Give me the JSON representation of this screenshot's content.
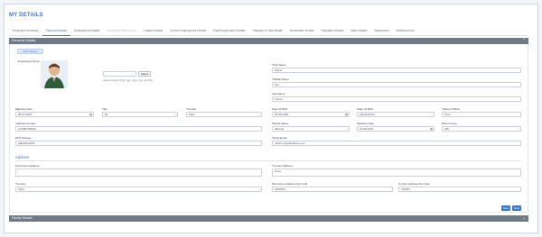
{
  "page": {
    "title": "MY DETAILS"
  },
  "tabs": [
    {
      "label": "Employee Summary",
      "state": "normal"
    },
    {
      "label": "Personal Details",
      "state": "active"
    },
    {
      "label": "Employment Details",
      "state": "normal"
    },
    {
      "label": "Employee Preferences",
      "state": "disabled"
    },
    {
      "label": "Contact Details",
      "state": "normal"
    },
    {
      "label": "Current Employment Details",
      "state": "normal"
    },
    {
      "label": "Past Employment Details",
      "state": "normal"
    },
    {
      "label": "Passport & Visa Details",
      "state": "normal"
    },
    {
      "label": "Nomination Details",
      "state": "normal"
    },
    {
      "label": "Education Details",
      "state": "normal"
    },
    {
      "label": "Bank Details",
      "state": "normal"
    },
    {
      "label": "Attachment",
      "state": "normal"
    },
    {
      "label": "Additional Info",
      "state": "normal"
    }
  ],
  "personal_panel": {
    "header": "Personal Details",
    "pill": "View History",
    "photo_label": "Employee Picture",
    "select_btn": "Select",
    "photo_hint": "(select image of Type: .jpg, .jpeg, .png, .gif only)",
    "fields": {
      "first_name": {
        "label": "*First Name",
        "value": "Nilesh"
      },
      "middle_name": {
        "label": "*Middle Name",
        "value": "Sen"
      },
      "last_name": {
        "label": "Last Name",
        "value": "Kumar"
      },
      "effective_date": {
        "label": "Effective Date",
        "value": "06-07-2015"
      },
      "title": {
        "label": "Title",
        "value": "Mr"
      },
      "gender": {
        "label": "*Gender",
        "value": "Male"
      },
      "dob": {
        "label": "Date Of Birth",
        "value": "09-08-1989"
      },
      "country_of_birth": {
        "label": "State Of Birth",
        "value": "Maharashtra"
      },
      "place_of_birth": {
        "label": "*Place Of Birth",
        "value": "Pune"
      },
      "aadhar": {
        "label": "Aadhaar Number",
        "value": "123456789012"
      },
      "marital": {
        "label": "Marital Status",
        "value": "Married"
      },
      "wedding": {
        "label": "Wedding Date",
        "value": "20-08-2015"
      },
      "blood": {
        "label": "Blood Group",
        "value": "AB+"
      },
      "pan": {
        "label": "PAN Number",
        "value": "ABCDE1234F"
      },
      "email": {
        "label": "*Work Email",
        "value": "nilesh.m@vibhalaya.com"
      }
    }
  },
  "address": {
    "title": "Address",
    "permanent": {
      "label": "Permanent Address",
      "value": ""
    },
    "current": {
      "label": "*Current Address",
      "value": "Pune"
    },
    "country": {
      "label": "*Country",
      "value": "India"
    },
    "perm_zip": {
      "label": "Permanent Address Zip Code",
      "value": "4000054"
    },
    "curr_zip": {
      "label": "Current Address Zip Code",
      "value": "411001"
    }
  },
  "actions": {
    "save": "Save",
    "next": "Next"
  },
  "family_panel": {
    "header": "Family Details"
  },
  "colors": {
    "accent": "#3c78c8",
    "panel_bar": "#6f7a88"
  }
}
